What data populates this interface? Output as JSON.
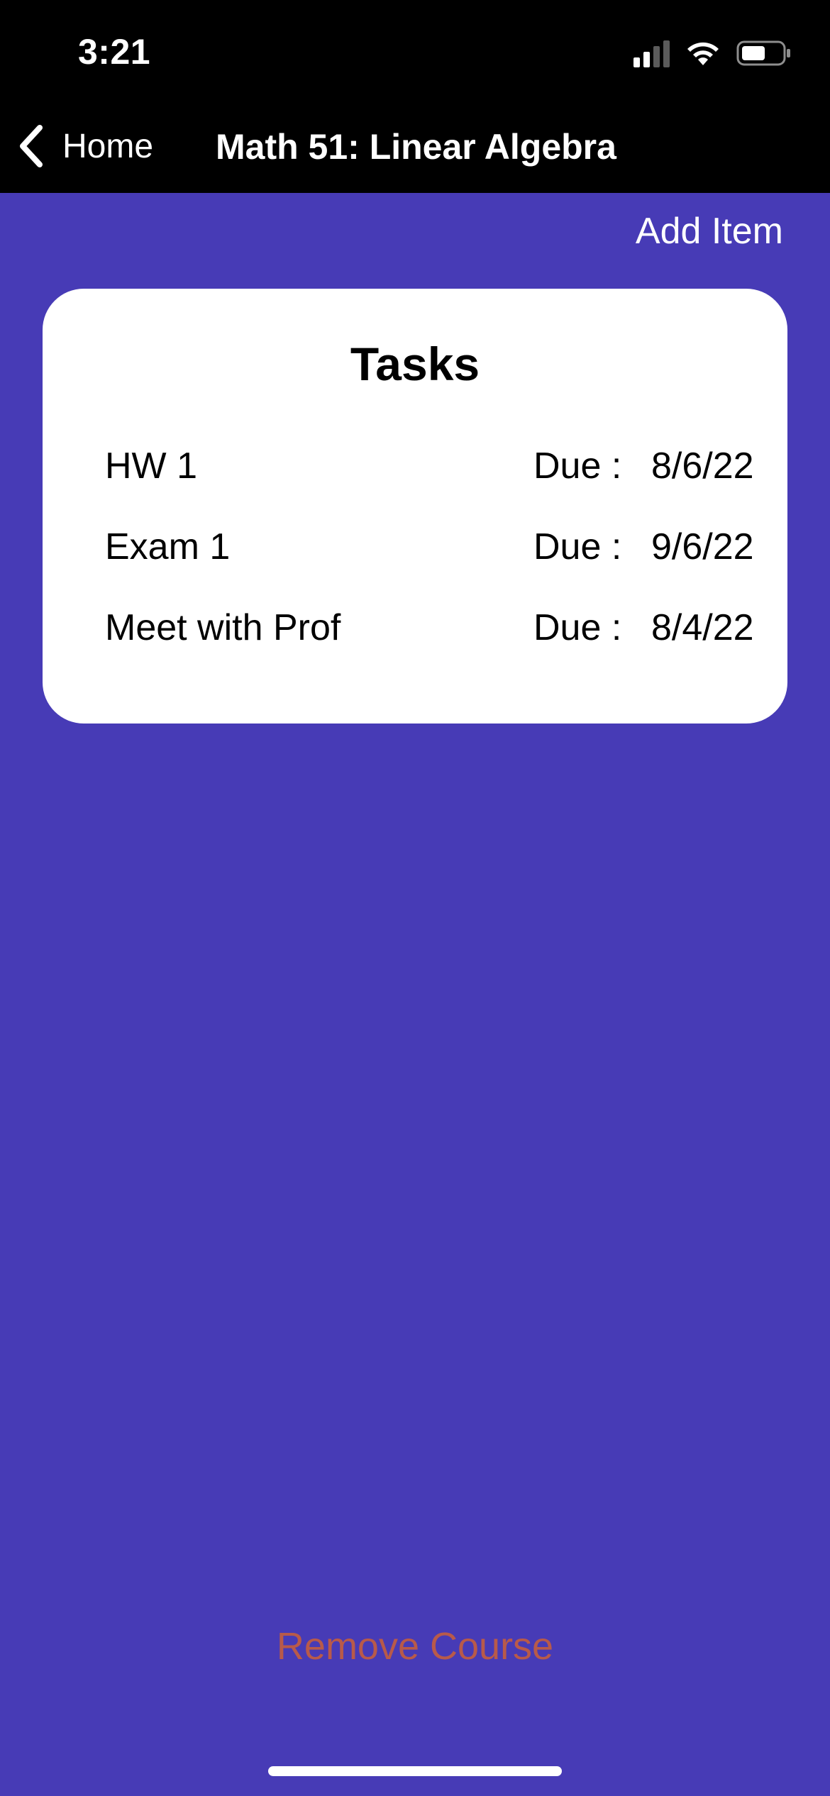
{
  "status_bar": {
    "time": "3:21",
    "signal_icon": "cellular-signal-icon",
    "wifi_icon": "wifi-icon",
    "battery_icon": "battery-icon"
  },
  "nav": {
    "back_icon": "chevron-left-icon",
    "back_label": "Home",
    "title": "Math 51: Linear Algebra"
  },
  "toolbar": {
    "add_item_label": "Add Item"
  },
  "tasks_card": {
    "title": "Tasks",
    "rows": [
      {
        "name": "HW 1",
        "due_label": "Due :",
        "due_date": "8/6/22"
      },
      {
        "name": "Exam 1",
        "due_label": "Due :",
        "due_date": "9/6/22"
      },
      {
        "name": "Meet with Prof",
        "due_label": "Due :",
        "due_date": "8/4/22"
      }
    ]
  },
  "footer": {
    "remove_course_label": "Remove Course"
  },
  "colors": {
    "background": "#473bb6",
    "bar": "#000000",
    "card": "#ffffff",
    "destructive": "#b85a4a"
  }
}
